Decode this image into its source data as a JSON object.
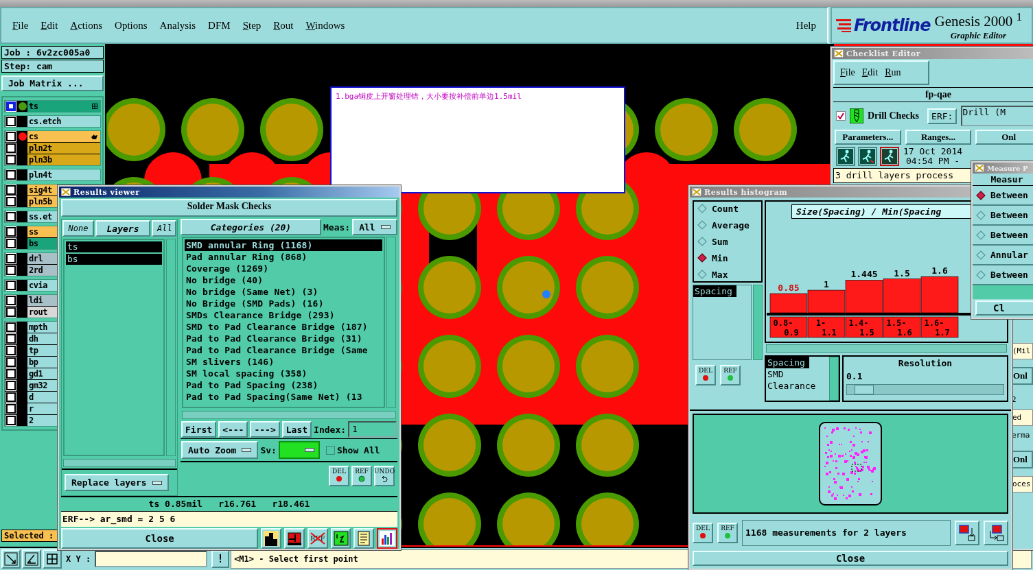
{
  "menu": {
    "items": [
      {
        "label": "File",
        "underline": true
      },
      {
        "label": "Edit",
        "underline": true
      },
      {
        "label": "Actions",
        "underline": true
      },
      {
        "label": "Options",
        "underline": false
      },
      {
        "label": "Analysis",
        "underline": false
      },
      {
        "label": "DFM",
        "underline": false
      },
      {
        "label": "Step",
        "underline": true
      },
      {
        "label": "Rout",
        "underline": true
      },
      {
        "label": "Windows",
        "underline": true
      }
    ],
    "help": {
      "label": "Help",
      "underline": false
    }
  },
  "logo": {
    "brand": "Frontline",
    "product": "Genesis 2000 $^{1}$",
    "subtitle": "Graphic Editor"
  },
  "job_panel": {
    "job": "Job : 6v2zc005a0",
    "step": "Step: cam",
    "matrix_button": "Job Matrix ..."
  },
  "layer_groups": [
    [
      {
        "name": "ts",
        "color": "#1aa47c",
        "marker": {
          "color": "#4a9a10"
        },
        "active": true,
        "kind": "grid"
      }
    ],
    [
      {
        "name": "cs.etch",
        "color": "#9ddcdc",
        "active": false,
        "kind": "plain"
      }
    ],
    [
      {
        "name": "cs",
        "color": "#f8c050",
        "marker": {
          "color": "#ff1010"
        },
        "active": false,
        "kind": "pointer"
      },
      {
        "name": "pln2t",
        "color": "#d8a818",
        "active": false,
        "kind": "plain"
      },
      {
        "name": "pln3b",
        "color": "#d8a818",
        "active": false,
        "kind": "plain"
      }
    ],
    [
      {
        "name": "pln4t",
        "color": "#9ddcdc",
        "active": false,
        "kind": "plain"
      }
    ],
    [
      {
        "name": "sig4t",
        "color": "#f8c050",
        "active": false,
        "kind": "plain"
      },
      {
        "name": "pln5b",
        "color": "#f8c050",
        "active": false,
        "kind": "plain"
      }
    ],
    [
      {
        "name": "ss.et",
        "color": "#9ddcdc",
        "active": false,
        "kind": "plain"
      }
    ],
    [
      {
        "name": "ss",
        "color": "#f8c050",
        "active": false,
        "kind": "plain"
      },
      {
        "name": "bs",
        "color": "#1aa47c",
        "active": false,
        "kind": "plain"
      }
    ],
    [
      {
        "name": "drl",
        "color": "#a8c0c8",
        "active": false,
        "kind": "plain"
      },
      {
        "name": "2rd",
        "color": "#a8c0c8",
        "active": false,
        "kind": "plain"
      }
    ],
    [
      {
        "name": "cvia",
        "color": "#9ddcdc",
        "active": false,
        "kind": "plain"
      }
    ],
    [
      {
        "name": "ldi",
        "color": "#a8c0c8",
        "active": false,
        "kind": "plain"
      },
      {
        "name": "rout",
        "color": "#d8d8d8",
        "active": false,
        "kind": "plain"
      }
    ],
    [
      {
        "name": "mpth",
        "color": "#9ddcdc",
        "active": false,
        "kind": "plain"
      },
      {
        "name": "dh",
        "color": "#9ddcdc",
        "active": false,
        "kind": "plain"
      },
      {
        "name": "tp",
        "color": "#9ddcdc",
        "active": false,
        "kind": "plain"
      },
      {
        "name": "bp",
        "color": "#9ddcdc",
        "active": false,
        "kind": "plain"
      },
      {
        "name": "gd1",
        "color": "#9ddcdc",
        "active": false,
        "kind": "plain"
      },
      {
        "name": "gm32",
        "color": "#9ddcdc",
        "active": false,
        "kind": "plain"
      },
      {
        "name": "d",
        "color": "#9ddcdc",
        "active": false,
        "kind": "plain"
      },
      {
        "name": "r",
        "color": "#9ddcdc",
        "active": false,
        "kind": "plain"
      },
      {
        "name": "2",
        "color": "#9ddcdc",
        "active": false,
        "kind": "plain"
      }
    ]
  ],
  "selected_label": "Selected :",
  "canvas_note": "1.bga铜皮上开窗处理错，大小要按补偿前单边1.5mil",
  "results_viewer": {
    "title": "Results viewer",
    "heading": "Solder Mask Checks",
    "layer_buttons": [
      "None",
      "Layers",
      "All"
    ],
    "layers": [
      {
        "label": "ts",
        "selected": true
      },
      {
        "label": "bs",
        "selected": true
      }
    ],
    "categories_button": "Categories (20)",
    "meas_label": "Meas:",
    "meas_value": "All",
    "categories": [
      {
        "label": "SMD annular Ring (1168)",
        "selected": true
      },
      {
        "label": "Pad annular Ring (868)",
        "selected": false
      },
      {
        "label": "Coverage (1269)",
        "selected": false
      },
      {
        "label": "No bridge (40)",
        "selected": false
      },
      {
        "label": "No bridge (Same Net) (3)",
        "selected": false
      },
      {
        "label": "No Bridge (SMD Pads) (16)",
        "selected": false
      },
      {
        "label": "SMDs Clearance Bridge (293)",
        "selected": false
      },
      {
        "label": "SMD to Pad Clearance Bridge (187)",
        "selected": false
      },
      {
        "label": "Pad to Pad Clearance Bridge (31)",
        "selected": false
      },
      {
        "label": "Pad to Pad Clearance Bridge (Same",
        "selected": false
      },
      {
        "label": "SM slivers (146)",
        "selected": false
      },
      {
        "label": "SM local spacing (358)",
        "selected": false
      },
      {
        "label": "Pad to Pad Spacing (238)",
        "selected": false
      },
      {
        "label": "Pad to Pad Spacing(Same Net) (13",
        "selected": false
      }
    ],
    "nav_buttons": [
      "First",
      "<---",
      "--->",
      "Last"
    ],
    "index_label": "Index:",
    "index_value": "1",
    "zoom_mode": "Auto Zoom",
    "sv": {
      "label": "Sv:",
      "color": "#22e022"
    },
    "show_all": {
      "label": "Show All",
      "checked": false
    },
    "replace_layers": "Replace layers",
    "edit_buttons": [
      {
        "label": "DEL",
        "kind": "del"
      },
      {
        "label": "REF",
        "kind": "ref"
      },
      {
        "label": "UNDO",
        "kind": "undo"
      }
    ],
    "status": "ts 0.85mil   r16.761   r18.461",
    "erf": "ERF--> ar_smd = 2 5 6",
    "close": "Close",
    "tool_icons": [
      {
        "kind": "profile",
        "selected": false
      },
      {
        "kind": "layer",
        "selected": false
      },
      {
        "kind": "ref-off",
        "label": "REF",
        "selected": false
      },
      {
        "kind": "numbers",
        "selected": false
      },
      {
        "kind": "report",
        "selected": false
      },
      {
        "kind": "histogram",
        "selected": true
      }
    ]
  },
  "checklist_editor": {
    "title": "Checklist Editor",
    "menu": [
      "File",
      "Edit",
      "Run"
    ],
    "name": "fp-qae",
    "check": {
      "label": "Drill Checks",
      "checked": true
    },
    "erf_button": "ERF:",
    "erf_value": "Drill (M",
    "buttons": [
      "Parameters...",
      "Ranges...",
      "Onl"
    ],
    "run_icons": [
      {
        "kind": "run"
      },
      {
        "kind": "run-alt"
      },
      {
        "kind": "run-stop"
      }
    ],
    "date": "17 Oct 2014",
    "time": "04:54 PM -",
    "status": "3 drill layers process",
    "fragments": [
      {
        "text": "(Mil",
        "kind": "field"
      },
      {
        "text": "Onl",
        "kind": "button"
      },
      {
        "text": "2",
        "kind": "text"
      },
      {
        "text": "ed",
        "kind": "field"
      },
      {
        "text": "erma",
        "kind": "text"
      },
      {
        "text": "Onl",
        "kind": "button"
      },
      {
        "text": "oces",
        "kind": "field"
      }
    ]
  },
  "measure_window": {
    "title": "Measure P",
    "heading": "Measur",
    "options": [
      {
        "label": "Between",
        "selected": true
      },
      {
        "label": "Between",
        "selected": false
      },
      {
        "label": "Between",
        "selected": false
      },
      {
        "label": "Annular",
        "selected": false
      },
      {
        "label": "Between",
        "selected": false
      }
    ],
    "close": "Cl"
  },
  "histogram": {
    "title": "Results histogram",
    "modes": [
      {
        "label": "Count",
        "selected": false
      },
      {
        "label": "Average",
        "selected": false
      },
      {
        "label": "Sum",
        "selected": false
      },
      {
        "label": "Min",
        "selected": true
      },
      {
        "label": "Max",
        "selected": false
      }
    ],
    "measures": [
      {
        "label": "Spacing",
        "selected": true
      }
    ],
    "measure_buttons": [
      {
        "label": "DEL",
        "kind": "del"
      },
      {
        "label": "REF",
        "kind": "ref"
      }
    ],
    "title_field": "Size(Spacing) / Min(Spacing",
    "chart_data": {
      "type": "bar",
      "categories": [
        "0.8-0.9",
        "1-1.1",
        "1.4-1.5",
        "1.5-1.6",
        "1.6-1.7"
      ],
      "values": [
        0.85,
        1,
        1.445,
        1.5,
        1.6
      ],
      "data_labels": true
    },
    "types": [
      {
        "label": "Spacing",
        "selected": true
      },
      {
        "label": "SMD",
        "selected": false
      },
      {
        "label": "Clearance",
        "selected": false
      }
    ],
    "resolution": {
      "label": "Resolution",
      "value": "0.1",
      "level": 0.05
    },
    "status_buttons": [
      {
        "label": "DEL",
        "kind": "del"
      },
      {
        "label": "REF",
        "kind": "ref"
      }
    ],
    "summary": "1168 measurements for 2 layers",
    "close": "Close"
  },
  "bottom_bar": {
    "xy_label": "X Y :",
    "warn": "!",
    "message": "<M1> - Select first point"
  }
}
